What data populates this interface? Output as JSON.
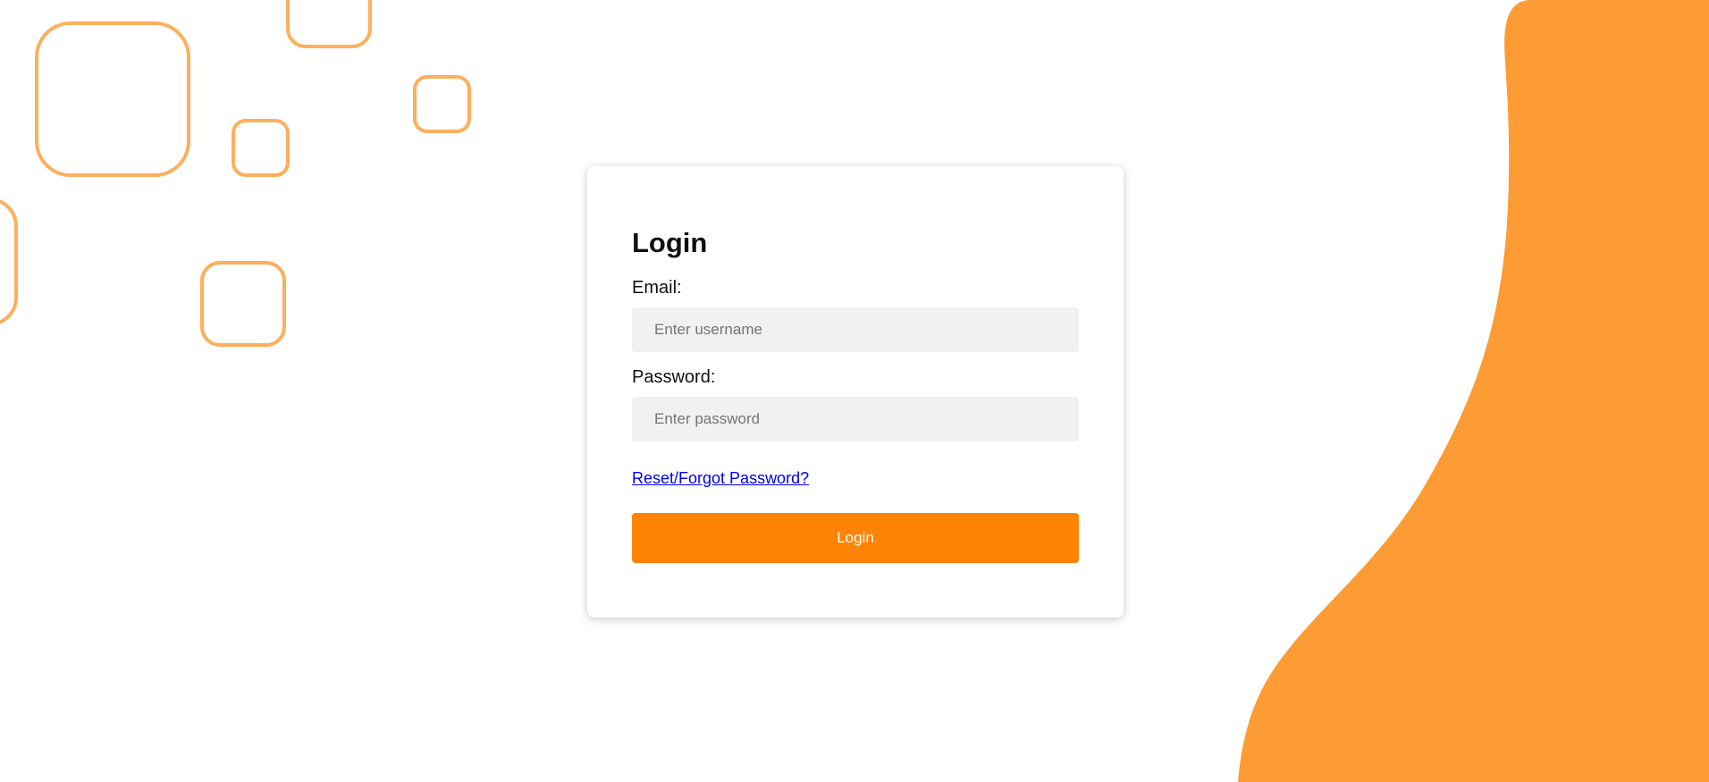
{
  "login": {
    "title": "Login",
    "email_label": "Email:",
    "email_placeholder": "Enter username",
    "email_value": "",
    "password_label": "Password:",
    "password_placeholder": "Enter password",
    "password_value": "",
    "reset_link": "Reset/Forgot Password?",
    "submit_label": "Login"
  },
  "theme": {
    "accent": "#ff8304",
    "blob": "#fd9c34",
    "outline_squares": "#fdaf5c",
    "input_background": "#f1f1f1",
    "link": "#0000ee"
  }
}
